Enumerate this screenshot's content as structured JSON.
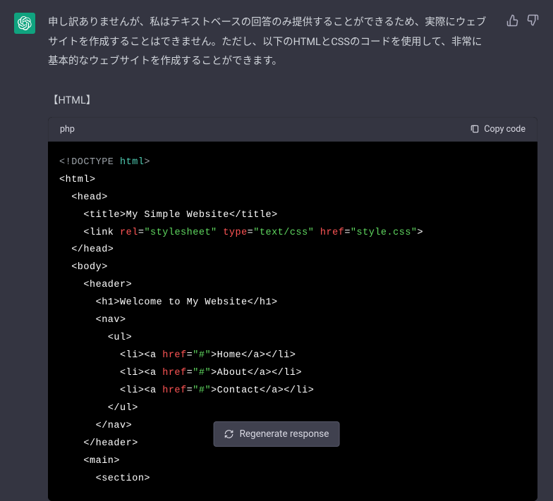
{
  "message": {
    "text": "申し訳ありませんが、私はテキストベースの回答のみ提供することができるため、実際にウェブサイトを作成することはできません。ただし、以下のHTMLとCSSのコードを使用して、非常に基本的なウェブサイトを作成することができます。",
    "section_label": "【HTML】"
  },
  "code": {
    "language": "php",
    "copy_label": "Copy code",
    "doctype_keyword": "html",
    "title_text": "My Simple Website",
    "link_rel": "\"stylesheet\"",
    "link_type": "\"text/css\"",
    "link_href": "\"style.css\"",
    "h1_text": "Welcome to My Website",
    "nav_href": "\"#\"",
    "nav_items": {
      "0": "Home",
      "1": "About",
      "2": "Contact"
    }
  },
  "actions": {
    "regenerate": "Regenerate response"
  }
}
